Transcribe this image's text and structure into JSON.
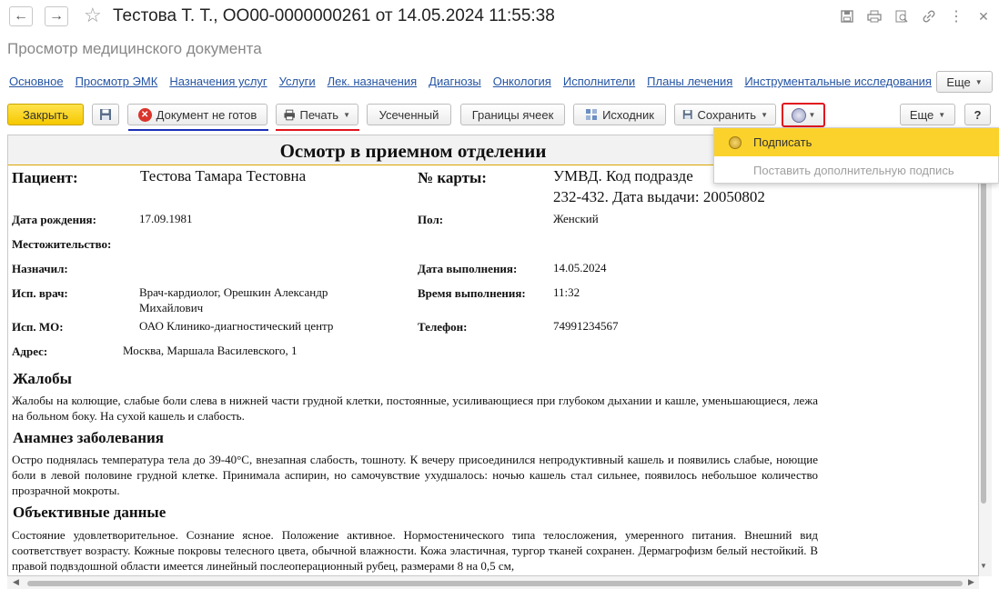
{
  "window": {
    "title": "Тестова Т. Т., ОО00-0000000261 от 14.05.2024 11:55:38",
    "subtitle": "Просмотр медицинского документа"
  },
  "links": [
    "Основное",
    "Просмотр ЭМК",
    "Назначения услуг",
    "Услуги",
    "Лек. назначения",
    "Диагнозы",
    "Онкология",
    "Исполнители",
    "Планы лечения",
    "Инструментальные исследования"
  ],
  "toolbar": {
    "more_top": "Еще",
    "close": "Закрыть",
    "not_ready": "Документ не готов",
    "print": "Печать",
    "truncated": "Усеченный",
    "cell_borders": "Границы ячеек",
    "source": "Исходник",
    "save": "Сохранить",
    "more": "Еще",
    "help": "?"
  },
  "dropdown": {
    "sign": "Подписать",
    "add_sign": "Поставить дополнительную подпись"
  },
  "document": {
    "heading": "Осмотр в приемном отделении",
    "patient_label": "Пациент:",
    "patient_value": "Тестова Тамара Тестовна",
    "card_label": "№ карты:",
    "card_value_1": "УМВД. Код подразде",
    "card_value_2": "232-432. Дата выдачи: 20050802",
    "birth_label": "Дата рождения:",
    "birth_value": "17.09.1981",
    "sex_label": "Пол:",
    "sex_value": "Женский",
    "residence_label": "Местожительство:",
    "assigned_label": "Назначил:",
    "exec_date_label": "Дата выполнения:",
    "exec_date_value": "14.05.2024",
    "doctor_label": "Исп. врач:",
    "doctor_value_1": "Врач-кардиолог, Орешкин Александр",
    "doctor_value_2": "Михайлович",
    "exec_time_label": "Время выполнения:",
    "exec_time_value": "11:32",
    "mo_label": "Исп. МО:",
    "mo_value": "ОАО Клинико-диагностический центр",
    "phone_label": "Телефон:",
    "phone_value": "74991234567",
    "address_label": "Адрес:",
    "address_value": "Москва, Маршала Василевского, 1",
    "complaints_title": "Жалобы",
    "complaints_text": "Жалобы на колющие, слабые боли слева в нижней части грудной клетки, постоянные, усиливающиеся при глубоком дыхании и кашле, уменьшающиеся, лежа на больном боку. На сухой кашель и слабость.",
    "anamnesis_title": "Анамнез заболевания",
    "anamnesis_text": "Остро поднялась температура тела до 39-40°С, внезапная слабость, тошноту. К вечеру присоединился непродуктивный кашель и появились слабые, ноющие боли в левой половине грудной клетке. Принимала аспирин, но самочувствие ухудшалось: ночью кашель стал сильнее, появилось небольшое количество прозрачной мокроты.",
    "objective_title": "Объективные данные",
    "objective_text": "Состояние удовлетворительное. Сознание ясное. Положение активное. Нормостенического типа телосложения, умеренного питания. Внешний вид соответствует возрасту. Кожные покровы телесного цвета, обычной влажности. Кожа эластичная, тургор тканей сохранен. Дермагрофизм белый нестойкий. В правой подвздошной области имеется линейный послеоперационный рубец, размерами 8 на 0,5 см,"
  }
}
